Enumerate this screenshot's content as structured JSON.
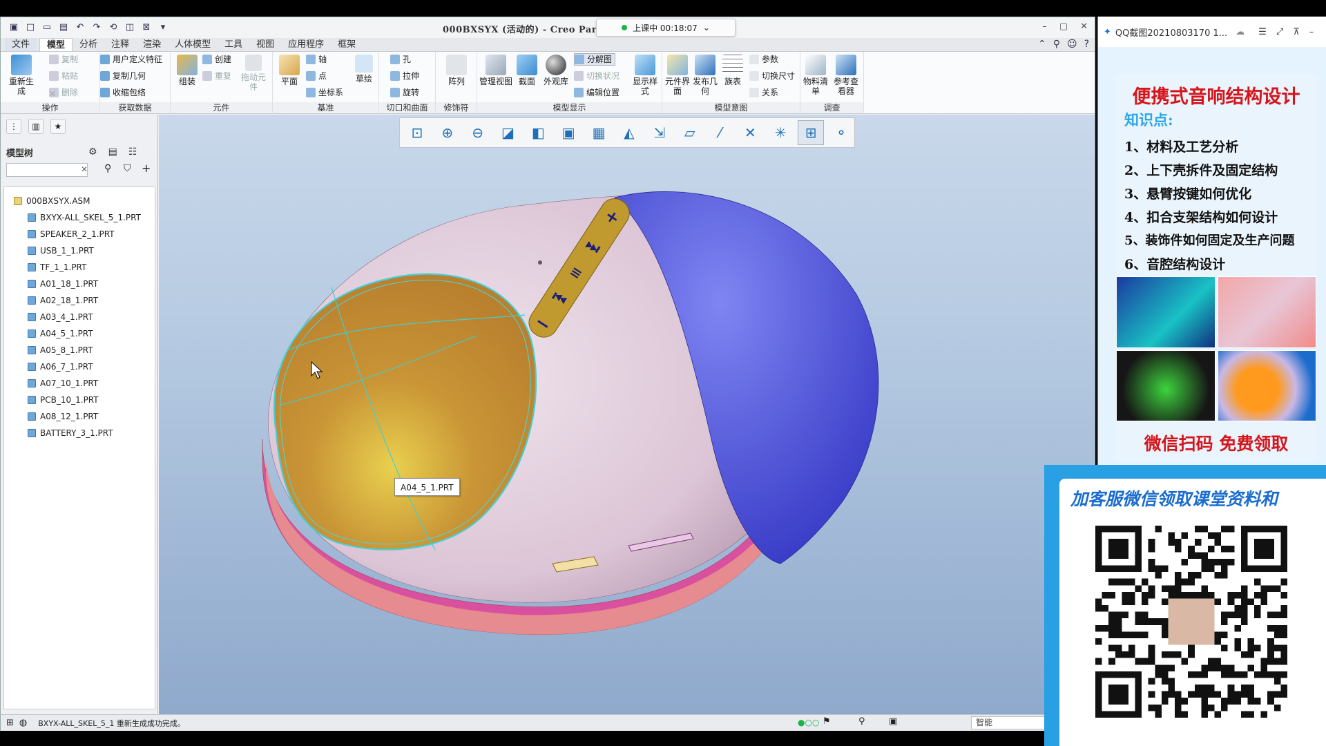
{
  "app": {
    "window_title": "000BXSYX (活动的) - Creo Parametric",
    "title_visible": "000BXSYX (活动的) - Creo Par",
    "class_timer": "上课中 00:18:07"
  },
  "tabs": [
    "文件",
    "模型",
    "分析",
    "注释",
    "渲染",
    "人体模型",
    "工具",
    "视图",
    "应用程序",
    "框架"
  ],
  "active_tab": "模型",
  "ribbon": {
    "groups": [
      {
        "label": "操作",
        "big": "重新生成",
        "small": [
          "复制",
          "粘贴",
          "删除"
        ]
      },
      {
        "label": "获取数据",
        "small": [
          "用户定义特征",
          "复制几何",
          "收缩包络"
        ]
      },
      {
        "label": "元件",
        "big": "组装",
        "small": [
          "创建",
          "重复"
        ],
        "extra": "拖动元件"
      },
      {
        "label": "基准",
        "big": "平面",
        "small": [
          "轴",
          "点",
          "坐标系"
        ],
        "extra": "草绘"
      },
      {
        "label": "切口和曲面",
        "small": [
          "孔",
          "拉伸",
          "旋转"
        ]
      },
      {
        "label": "修饰符",
        "big": "阵列"
      },
      {
        "label": "模型显示",
        "bigs": [
          "管理视图",
          "截面",
          "外观库"
        ],
        "small": [
          "分解图",
          "切换状况",
          "编辑位置"
        ],
        "extra": "显示样式"
      },
      {
        "label": "模型意图",
        "bigs": [
          "元件界面",
          "发布几何",
          "族表"
        ],
        "small": [
          "参数",
          "切换尺寸",
          "关系"
        ]
      },
      {
        "label": "调查",
        "bigs": [
          "物料清单",
          "参考查看器"
        ]
      }
    ]
  },
  "model_tree": {
    "header": "模型树",
    "root": "000BXSYX.ASM",
    "items": [
      "BXYX-ALL_SKEL_5_1.PRT",
      "SPEAKER_2_1.PRT",
      "USB_1_1.PRT",
      "TF_1_1.PRT",
      "A01_18_1.PRT",
      "A02_18_1.PRT",
      "A03_4_1.PRT",
      "A04_5_1.PRT",
      "A05_8_1.PRT",
      "A06_7_1.PRT",
      "A07_10_1.PRT",
      "PCB_10_1.PRT",
      "A08_12_1.PRT",
      "BATTERY_3_1.PRT"
    ]
  },
  "viewport": {
    "tooltip": "A04_5_1.PRT",
    "colors": {
      "shell_top": "#d9c6d6",
      "cap_blue": "#5b5fe0",
      "grille": "#c7903a",
      "band": "#e34fb7",
      "buttons": "#b38a2a"
    }
  },
  "status": {
    "message": "BXYX-ALL_SKEL_5_1 重新生成成功完成。",
    "filter": "智能"
  },
  "qq_viewer": {
    "title": "QQ截图20210803170 1...",
    "poster_title": "便携式音响结构设计",
    "poster_sub": "知识点:",
    "points": [
      "1、材料及工艺分析",
      "2、上下壳拆件及固定结构",
      "3、悬臂按键如何优化",
      "4、扣合支架结构如何设计",
      "5、装饰件如何固定及生产问题",
      "6、音腔结构设计"
    ],
    "cta": "微信扫码 免费领取"
  },
  "qr_overlay": {
    "text": "加客服微信领取课堂资料和"
  }
}
